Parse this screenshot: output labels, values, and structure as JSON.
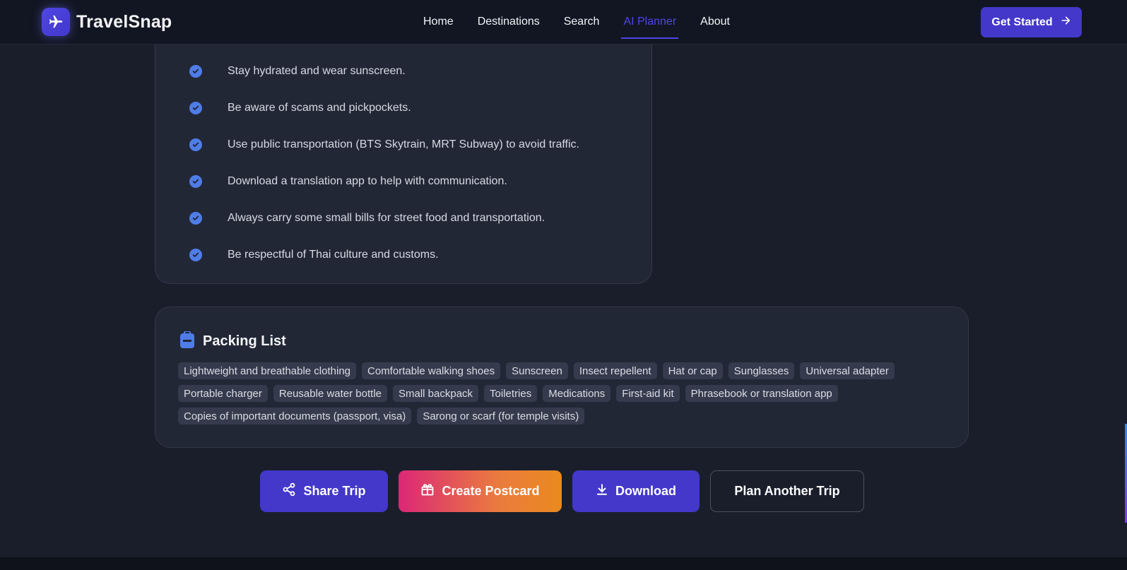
{
  "brand": {
    "name": "TravelSnap"
  },
  "nav": {
    "items": [
      {
        "label": "Home"
      },
      {
        "label": "Destinations"
      },
      {
        "label": "Search"
      },
      {
        "label": "AI Planner"
      },
      {
        "label": "About"
      }
    ],
    "active": "AI Planner"
  },
  "header": {
    "cta_label": "Get Started"
  },
  "tips": [
    "Stay hydrated and wear sunscreen.",
    "Be aware of scams and pickpockets.",
    "Use public transportation (BTS Skytrain, MRT Subway) to avoid traffic.",
    "Download a translation app to help with communication.",
    "Always carry some small bills for street food and transportation.",
    "Be respectful of Thai culture and customs."
  ],
  "packing": {
    "title": "Packing List",
    "items": [
      "Lightweight and breathable clothing",
      "Comfortable walking shoes",
      "Sunscreen",
      "Insect repellent",
      "Hat or cap",
      "Sunglasses",
      "Universal adapter",
      "Portable charger",
      "Reusable water bottle",
      "Small backpack",
      "Toiletries",
      "Medications",
      "First-aid kit",
      "Phrasebook or translation app",
      "Copies of important documents (passport, visa)",
      "Sarong or scarf (for temple visits)"
    ]
  },
  "actions": {
    "share": "Share Trip",
    "postcard": "Create Postcard",
    "download": "Download",
    "plan_another": "Plan Another Trip"
  },
  "colors": {
    "accent": "#4338ca",
    "active_nav": "#4f46e5",
    "check": "#4f7de8",
    "postcard_gradient_start": "#db2777",
    "postcard_gradient_end": "#ea8a1f"
  }
}
